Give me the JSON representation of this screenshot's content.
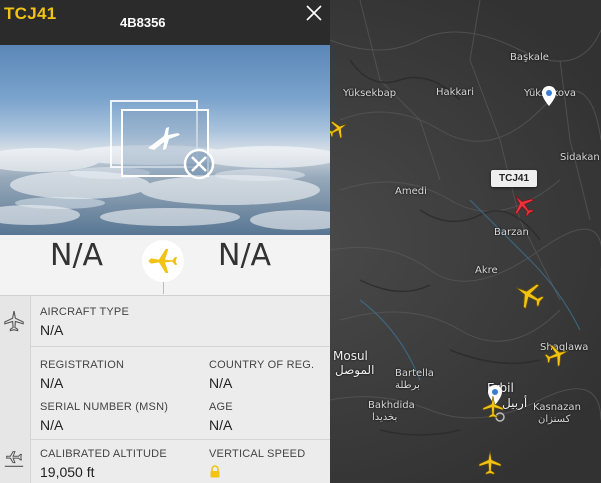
{
  "flight": {
    "callsign": "TCJ41",
    "hex_code": "4B8356"
  },
  "photo": {
    "placeholder_icon": "no-photo-plane-icon"
  },
  "route": {
    "origin": "N/A",
    "destination": "N/A"
  },
  "details": {
    "aircraft_type_label": "AIRCRAFT TYPE",
    "aircraft_type_value": "N/A",
    "registration_label": "REGISTRATION",
    "registration_value": "N/A",
    "country_label": "COUNTRY OF REG.",
    "country_value": "N/A",
    "serial_label": "SERIAL NUMBER (MSN)",
    "serial_value": "N/A",
    "age_label": "AGE",
    "age_value": "N/A",
    "altitude_label": "CALIBRATED ALTITUDE",
    "altitude_value": "19,050 ft",
    "vspeed_label": "VERTICAL SPEED"
  },
  "map": {
    "callout": "TCJ41",
    "labels": [
      "Hakkari",
      "Yüksekova",
      "Başkale",
      "Amedi",
      "Akre",
      "Barzan",
      "Mosul",
      "الموصل",
      "Bartella",
      "برطلة",
      "Bakhdida",
      "بخديدا",
      "Erbil",
      "أربيل",
      "Kasnazan",
      "كسنزان",
      "Shaqlawa",
      "Sidakan",
      "Yüksekbap"
    ]
  },
  "colors": {
    "accent": "#f2c315",
    "selected_plane": "#e8323c",
    "plane": "#f2c315"
  }
}
